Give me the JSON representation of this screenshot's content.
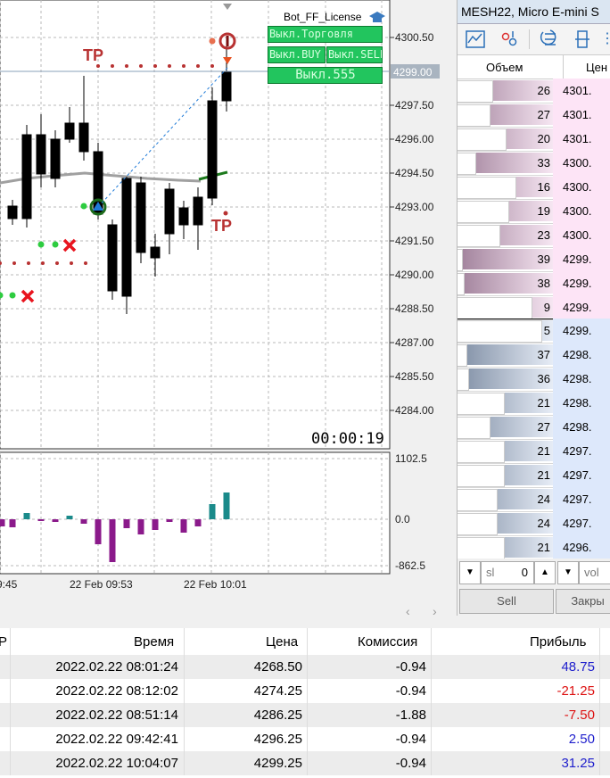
{
  "chart": {
    "robot_name": "Bot_FF_License",
    "btn_trade": "Выкл.Торговля",
    "btn_buy": "Выкл.BUY",
    "btn_sell": "Выкл.SELL",
    "btn_555": "Выкл.555",
    "tp_top": "TP",
    "tp_bottom": "TP",
    "timer": "00:00:19",
    "current_price": "4299.00",
    "price_axis": [
      "4300.50",
      "4297.50",
      "4296.00",
      "4294.50",
      "4293.00",
      "4291.50",
      "4290.00",
      "4288.50",
      "4287.00",
      "4285.50",
      "4284.00"
    ],
    "indicator_axis": [
      "1102.5",
      "0.0",
      "-862.5"
    ],
    "time_axis": [
      "9:45",
      "22 Feb 09:53",
      "22 Feb 10:01"
    ],
    "colors": {
      "bull": "#ffffff",
      "bear": "#000000",
      "ma": "#a0a0a0",
      "tp_dots": "#b83232",
      "histogram_neg": "#8b1a8b",
      "histogram_pos": "#1a8a8a",
      "button_green": "#22c55e"
    }
  },
  "dom": {
    "title": "MESH22, Micro E-mini S",
    "col_volume": "Объем",
    "col_price": "Цен",
    "asks": [
      {
        "vol": "26",
        "price": "4301."
      },
      {
        "vol": "27",
        "price": "4301."
      },
      {
        "vol": "20",
        "price": "4301."
      },
      {
        "vol": "33",
        "price": "4300."
      },
      {
        "vol": "16",
        "price": "4300."
      },
      {
        "vol": "19",
        "price": "4300."
      },
      {
        "vol": "23",
        "price": "4300."
      },
      {
        "vol": "39",
        "price": "4299."
      },
      {
        "vol": "38",
        "price": "4299."
      },
      {
        "vol": "9",
        "price": "4299."
      }
    ],
    "bids": [
      {
        "vol": "5",
        "price": "4299."
      },
      {
        "vol": "37",
        "price": "4298."
      },
      {
        "vol": "36",
        "price": "4298."
      },
      {
        "vol": "21",
        "price": "4298."
      },
      {
        "vol": "27",
        "price": "4298."
      },
      {
        "vol": "21",
        "price": "4297."
      },
      {
        "vol": "21",
        "price": "4297."
      },
      {
        "vol": "24",
        "price": "4297."
      },
      {
        "vol": "24",
        "price": "4297."
      },
      {
        "vol": "21",
        "price": "4296."
      }
    ],
    "sl_label": "sl",
    "sl_value": "0",
    "vol_label": "vol",
    "sell_button": "Sell",
    "close_button": "Закры"
  },
  "history": {
    "col_p": "P",
    "col_time": "Время",
    "col_price": "Цена",
    "col_commission": "Комиссия",
    "col_profit": "Прибыль",
    "rows": [
      {
        "time": "2022.02.22 08:01:24",
        "price": "4268.50",
        "commission": "-0.94",
        "profit": "48.75",
        "profit_color": "#1e1ecc"
      },
      {
        "time": "2022.02.22 08:12:02",
        "price": "4274.25",
        "commission": "-0.94",
        "profit": "-21.25",
        "profit_color": "#dd1111"
      },
      {
        "time": "2022.02.22 08:51:14",
        "price": "4286.25",
        "commission": "-1.88",
        "profit": "-7.50",
        "profit_color": "#dd1111"
      },
      {
        "time": "2022.02.22 09:42:41",
        "price": "4296.25",
        "commission": "-0.94",
        "profit": "2.50",
        "profit_color": "#1e1ecc"
      },
      {
        "time": "2022.02.22 10:04:07",
        "price": "4299.25",
        "commission": "-0.94",
        "profit": "31.25",
        "profit_color": "#1e1ecc"
      }
    ]
  }
}
